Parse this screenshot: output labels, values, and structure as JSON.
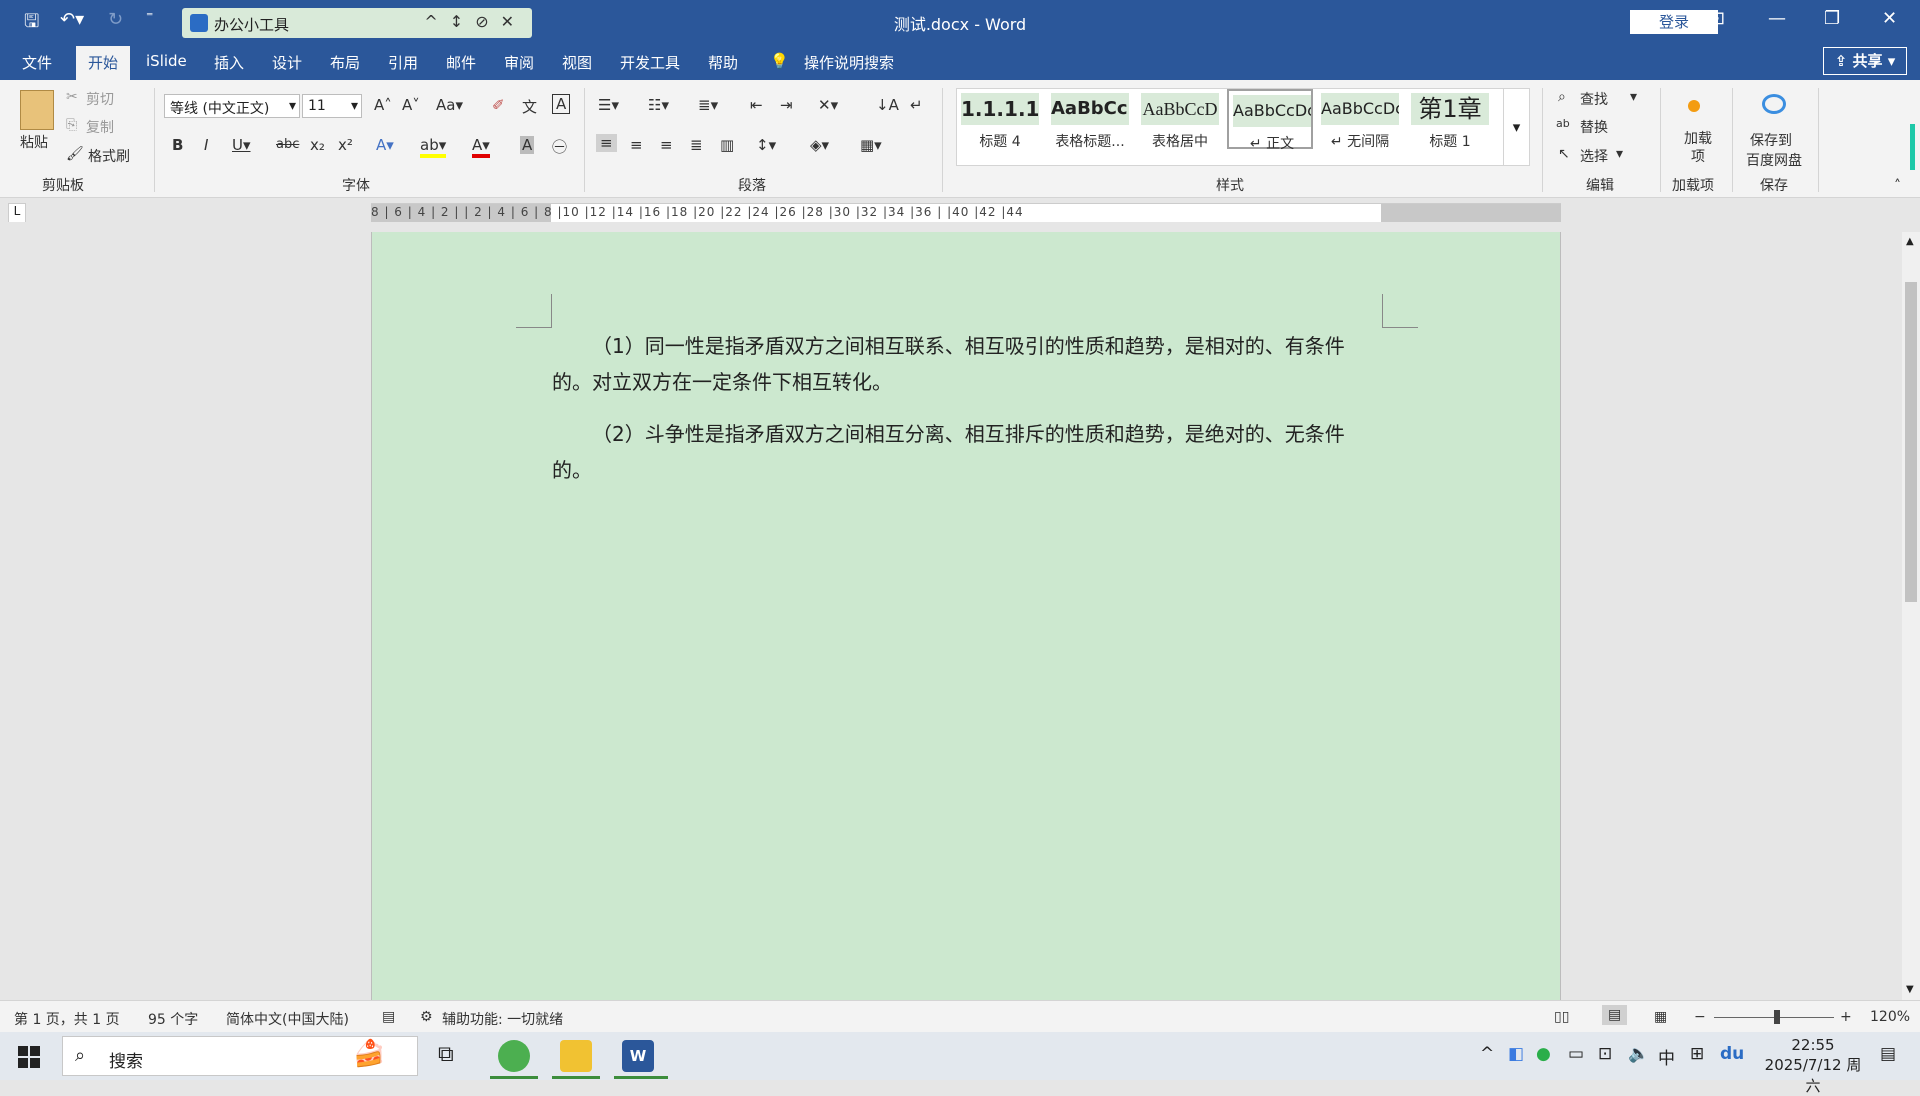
{
  "titlebar": {
    "toolbox_name": "办公小工具",
    "doc_title": "测试.docx - Word",
    "login": "登录"
  },
  "menu": {
    "tabs": [
      "文件",
      "开始",
      "iSlide",
      "插入",
      "设计",
      "布局",
      "引用",
      "邮件",
      "审阅",
      "视图",
      "开发工具",
      "帮助"
    ],
    "search": "操作说明搜索",
    "share": "共享"
  },
  "ribbon": {
    "clipboard": {
      "paste": "粘贴",
      "cut": "剪切",
      "copy": "复制",
      "format_painter": "格式刷",
      "label": "剪贴板"
    },
    "font": {
      "name": "等线 (中文正文)",
      "size": "11",
      "label": "字体"
    },
    "paragraph": {
      "label": "段落"
    },
    "styles": {
      "label": "样式",
      "items": [
        {
          "preview": "1.1.1.1",
          "name": "标题 4"
        },
        {
          "preview": "AaBbCcI",
          "name": "表格标题..."
        },
        {
          "preview": "AaBbCcD",
          "name": "表格居中"
        },
        {
          "preview": "AaBbCcDc",
          "name": "↵ 正文"
        },
        {
          "preview": "AaBbCcDc",
          "name": "↵ 无间隔"
        },
        {
          "preview": "第1章",
          "name": "标题 1"
        }
      ]
    },
    "editing": {
      "find": "查找",
      "replace": "替换",
      "select": "选择",
      "label": "编辑"
    },
    "addins": {
      "btn": "加载项",
      "label": "加载项"
    },
    "save": {
      "btn1": "保存到",
      "btn2": "百度网盘",
      "label": "保存"
    }
  },
  "ruler": {
    "h_numbers": "8 | 6 | 4 | 2 |   | 2 | 4 | 6 | 8 |10 |12 |14 |16 |18 |20 |22 |24 |26 |28 |30 |32 |34 |36 |   |40 |42 |44"
  },
  "document": {
    "paragraphs": [
      "（1）同一性是指矛盾双方之间相互联系、相互吸引的性质和趋势，是相对的、有条件的。对立双方在一定条件下相互转化。",
      "（2）斗争性是指矛盾双方之间相互分离、相互排斥的性质和趋势，是绝对的、无条件的。"
    ]
  },
  "status": {
    "page": "第 1 页，共 1 页",
    "words": "95 个字",
    "lang": "简体中文(中国大陆)",
    "accessibility": "辅助功能: 一切就绪",
    "zoom": "120%"
  },
  "taskbar": {
    "search": "搜索",
    "time": "22:55",
    "date": "2025/7/12 周六",
    "ime": "中"
  }
}
